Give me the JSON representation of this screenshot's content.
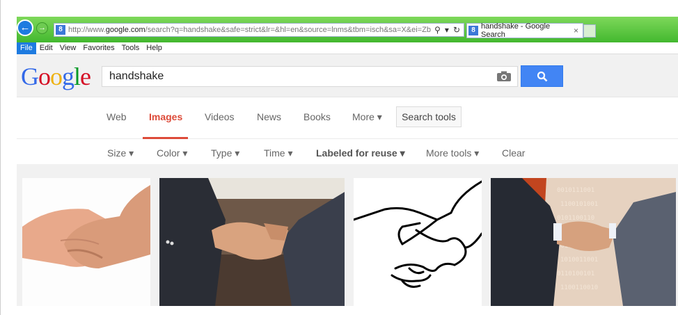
{
  "browser": {
    "address_prefix": "http://www.",
    "address_domain": "google.com",
    "address_rest": "/search?q=handshake&safe=strict&lr=&hl=en&source=lnms&tbm=isch&sa=X&ei=Zbbs\\",
    "address_favicon": "8",
    "tab_title": "handshake - Google Search",
    "tab_close": "×",
    "menu": [
      "File",
      "Edit",
      "View",
      "Favorites",
      "Tools",
      "Help"
    ]
  },
  "google": {
    "query": "handshake",
    "nav": {
      "web": "Web",
      "images": "Images",
      "videos": "Videos",
      "news": "News",
      "books": "Books",
      "more": "More ▾",
      "search_tools": "Search tools"
    },
    "filters": {
      "size": "Size ▾",
      "color": "Color ▾",
      "type": "Type ▾",
      "time": "Time ▾",
      "labeled": "Labeled for reuse ▾",
      "more_tools": "More tools ▾",
      "clear": "Clear"
    }
  },
  "colors": {
    "accent_red": "#dd4b39",
    "search_blue": "#4285f4",
    "ie_green": "#43b82f"
  },
  "icons": [
    "back-icon",
    "forward-icon",
    "camera-icon",
    "search-icon",
    "refresh-icon",
    "dropdown-icon"
  ]
}
